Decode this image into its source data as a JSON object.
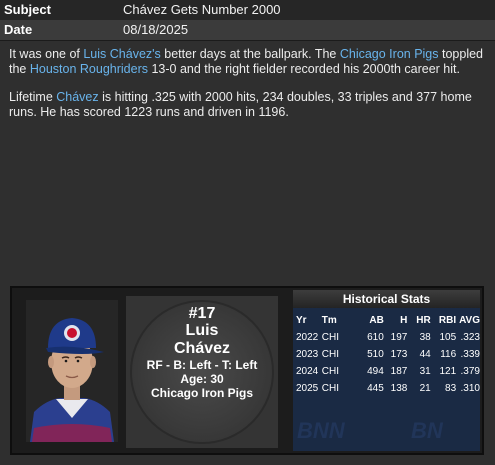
{
  "header": {
    "subject_label": "Subject",
    "subject_value": "Chávez Gets Number 2000",
    "date_label": "Date",
    "date_value": "08/18/2025"
  },
  "story": {
    "p1": [
      {
        "text": "It was one of ",
        "link": false
      },
      {
        "text": "Luis Chávez's",
        "link": true
      },
      {
        "text": " better days at the ballpark. The ",
        "link": false
      },
      {
        "text": "Chicago Iron Pigs",
        "link": true
      },
      {
        "text": " toppled the ",
        "link": false
      },
      {
        "text": "Houston Roughriders",
        "link": true
      },
      {
        "text": " 13-0 and the right fielder recorded his 2000th career hit.",
        "link": false
      }
    ],
    "p2": [
      {
        "text": "Lifetime ",
        "link": false
      },
      {
        "text": "Chávez",
        "link": true
      },
      {
        "text": " is hitting .325 with 2000 hits, 234 doubles, 33 triples and 377 home runs. He has scored 1223 runs and driven in 1196.",
        "link": false
      }
    ]
  },
  "player": {
    "number": "#17",
    "first_name": "Luis",
    "last_name": "Chávez",
    "position_line": "RF - B: Left - T: Left",
    "age_line": "Age: 30",
    "team": "Chicago Iron Pigs"
  },
  "historical": {
    "title": "Historical Stats",
    "columns": [
      "Yr",
      "Tm",
      "AB",
      "H",
      "HR",
      "RBI",
      "AVG"
    ],
    "rows": [
      [
        "2022",
        "CHI",
        "610",
        "197",
        "38",
        "105",
        ".323"
      ],
      [
        "2023",
        "CHI",
        "510",
        "173",
        "44",
        "116",
        ".339"
      ],
      [
        "2024",
        "CHI",
        "494",
        "187",
        "31",
        "121",
        ".379"
      ],
      [
        "2025",
        "CHI",
        "445",
        "138",
        "21",
        "83",
        ".310"
      ]
    ]
  },
  "colors": {
    "link": "#69b4ec",
    "stats_bg": "#1a2a44",
    "cap": "#1f3a8a"
  }
}
